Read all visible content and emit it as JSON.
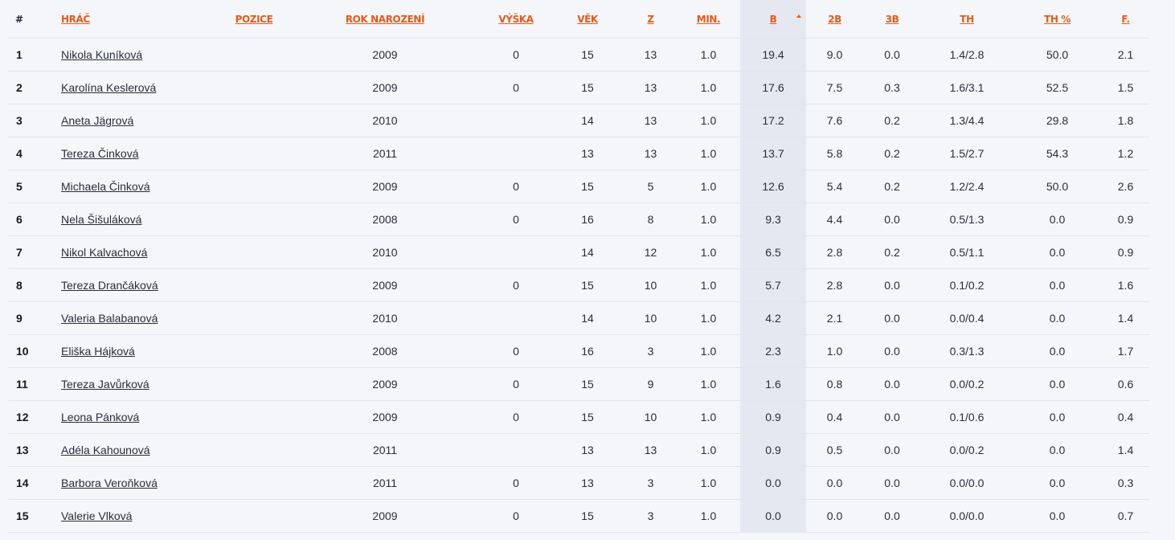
{
  "headers": {
    "rank": "#",
    "player": "HRÁČ",
    "position": "POZICE",
    "birth_year": "ROK NAROZENÍ",
    "height": "VÝŠKA",
    "age": "VĚK",
    "games": "Z",
    "minutes": "MIN.",
    "points": "B",
    "two_pt": "2B",
    "three_pt": "3B",
    "free_throws": "TH",
    "free_throw_pct": "TH %",
    "fouls": "F."
  },
  "sort": {
    "column": "points",
    "direction": "desc",
    "indicator": "sort-up-icon",
    "color": "#e55a1c"
  },
  "rows": [
    {
      "rank": "1",
      "player": "Nikola Kuníková",
      "position": "",
      "birth_year": "2009",
      "height": "0",
      "age": "15",
      "games": "13",
      "minutes": "1.0",
      "points": "19.4",
      "two_pt": "9.0",
      "three_pt": "0.0",
      "free_throws": "1.4/2.8",
      "free_throw_pct": "50.0",
      "fouls": "2.1"
    },
    {
      "rank": "2",
      "player": "Karolína Keslerová",
      "position": "",
      "birth_year": "2009",
      "height": "0",
      "age": "15",
      "games": "13",
      "minutes": "1.0",
      "points": "17.6",
      "two_pt": "7.5",
      "three_pt": "0.3",
      "free_throws": "1.6/3.1",
      "free_throw_pct": "52.5",
      "fouls": "1.5"
    },
    {
      "rank": "3",
      "player": "Aneta Jägrová",
      "position": "",
      "birth_year": "2010",
      "height": "",
      "age": "14",
      "games": "13",
      "minutes": "1.0",
      "points": "17.2",
      "two_pt": "7.6",
      "three_pt": "0.2",
      "free_throws": "1.3/4.4",
      "free_throw_pct": "29.8",
      "fouls": "1.8"
    },
    {
      "rank": "4",
      "player": "Tereza Činková",
      "position": "",
      "birth_year": "2011",
      "height": "",
      "age": "13",
      "games": "13",
      "minutes": "1.0",
      "points": "13.7",
      "two_pt": "5.8",
      "three_pt": "0.2",
      "free_throws": "1.5/2.7",
      "free_throw_pct": "54.3",
      "fouls": "1.2"
    },
    {
      "rank": "5",
      "player": "Michaela Činková",
      "position": "",
      "birth_year": "2009",
      "height": "0",
      "age": "15",
      "games": "5",
      "minutes": "1.0",
      "points": "12.6",
      "two_pt": "5.4",
      "three_pt": "0.2",
      "free_throws": "1.2/2.4",
      "free_throw_pct": "50.0",
      "fouls": "2.6"
    },
    {
      "rank": "6",
      "player": "Nela Šišuláková",
      "position": "",
      "birth_year": "2008",
      "height": "0",
      "age": "16",
      "games": "8",
      "minutes": "1.0",
      "points": "9.3",
      "two_pt": "4.4",
      "three_pt": "0.0",
      "free_throws": "0.5/1.3",
      "free_throw_pct": "0.0",
      "fouls": "0.9"
    },
    {
      "rank": "7",
      "player": "Nikol Kalvachová",
      "position": "",
      "birth_year": "2010",
      "height": "",
      "age": "14",
      "games": "12",
      "minutes": "1.0",
      "points": "6.5",
      "two_pt": "2.8",
      "three_pt": "0.2",
      "free_throws": "0.5/1.1",
      "free_throw_pct": "0.0",
      "fouls": "0.9"
    },
    {
      "rank": "8",
      "player": "Tereza Drančáková",
      "position": "",
      "birth_year": "2009",
      "height": "0",
      "age": "15",
      "games": "10",
      "minutes": "1.0",
      "points": "5.7",
      "two_pt": "2.8",
      "three_pt": "0.0",
      "free_throws": "0.1/0.2",
      "free_throw_pct": "0.0",
      "fouls": "1.6"
    },
    {
      "rank": "9",
      "player": "Valeria Balabanová",
      "position": "",
      "birth_year": "2010",
      "height": "",
      "age": "14",
      "games": "10",
      "minutes": "1.0",
      "points": "4.2",
      "two_pt": "2.1",
      "three_pt": "0.0",
      "free_throws": "0.0/0.4",
      "free_throw_pct": "0.0",
      "fouls": "1.4"
    },
    {
      "rank": "10",
      "player": "Eliška Hájková",
      "position": "",
      "birth_year": "2008",
      "height": "0",
      "age": "16",
      "games": "3",
      "minutes": "1.0",
      "points": "2.3",
      "two_pt": "1.0",
      "three_pt": "0.0",
      "free_throws": "0.3/1.3",
      "free_throw_pct": "0.0",
      "fouls": "1.7"
    },
    {
      "rank": "11",
      "player": "Tereza Javůrková",
      "position": "",
      "birth_year": "2009",
      "height": "0",
      "age": "15",
      "games": "9",
      "minutes": "1.0",
      "points": "1.6",
      "two_pt": "0.8",
      "three_pt": "0.0",
      "free_throws": "0.0/0.2",
      "free_throw_pct": "0.0",
      "fouls": "0.6"
    },
    {
      "rank": "12",
      "player": "Leona Pánková",
      "position": "",
      "birth_year": "2009",
      "height": "0",
      "age": "15",
      "games": "10",
      "minutes": "1.0",
      "points": "0.9",
      "two_pt": "0.4",
      "three_pt": "0.0",
      "free_throws": "0.1/0.6",
      "free_throw_pct": "0.0",
      "fouls": "0.4"
    },
    {
      "rank": "13",
      "player": "Adéla Kahounová",
      "position": "",
      "birth_year": "2011",
      "height": "",
      "age": "13",
      "games": "13",
      "minutes": "1.0",
      "points": "0.9",
      "two_pt": "0.5",
      "three_pt": "0.0",
      "free_throws": "0.0/0.2",
      "free_throw_pct": "0.0",
      "fouls": "1.4"
    },
    {
      "rank": "14",
      "player": "Barbora Veroňková",
      "position": "",
      "birth_year": "2011",
      "height": "0",
      "age": "13",
      "games": "3",
      "minutes": "1.0",
      "points": "0.0",
      "two_pt": "0.0",
      "three_pt": "0.0",
      "free_throws": "0.0/0.0",
      "free_throw_pct": "0.0",
      "fouls": "0.3"
    },
    {
      "rank": "15",
      "player": "Valerie Vlková",
      "position": "",
      "birth_year": "2009",
      "height": "0",
      "age": "15",
      "games": "3",
      "minutes": "1.0",
      "points": "0.0",
      "two_pt": "0.0",
      "three_pt": "0.0",
      "free_throws": "0.0/0.0",
      "free_throw_pct": "0.0",
      "fouls": "0.7"
    }
  ]
}
